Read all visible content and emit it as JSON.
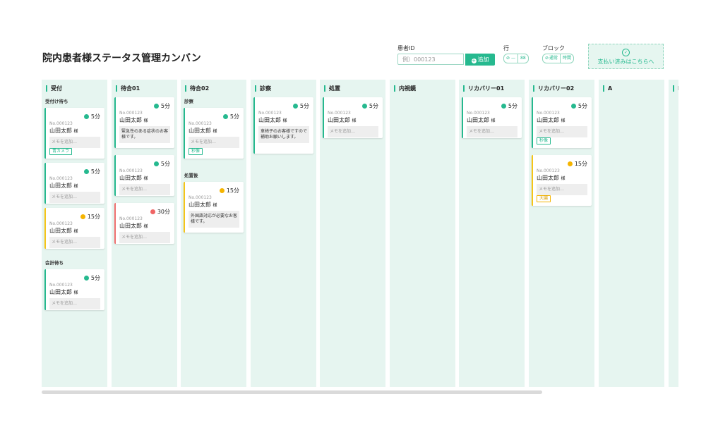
{
  "title": "院内患者様ステータス管理カンバン",
  "controls": {
    "patient_id_label": "患者ID",
    "patient_id_placeholder": "例）000123",
    "add_label": "追加",
    "row_label": "行",
    "row_toggle": [
      "—",
      "88"
    ],
    "block_label": "ブロック",
    "block_toggle": [
      "通常",
      "時間"
    ],
    "pay_label": "支払い済みはこちらへ"
  },
  "columns": [
    {
      "title": "受付",
      "groups": [
        {
          "label": "受付け待ち",
          "cards": [
            {
              "time": "5分",
              "status": "green",
              "no": "No.000123",
              "name": "山田太郎",
              "honor": "様",
              "memo": "メモを追加…",
              "memo_filled": false,
              "tag": "青カメラ",
              "tag_color": "green"
            },
            {
              "time": "5分",
              "status": "green",
              "no": "No.000123",
              "name": "山田太郎",
              "honor": "様",
              "memo": "メモを追加…",
              "memo_filled": false
            },
            {
              "time": "15分",
              "status": "yellow",
              "no": "No.000123",
              "name": "山田太郎",
              "honor": "様",
              "memo": "メモを追加…",
              "memo_filled": false
            }
          ]
        },
        {
          "label": "会計待ち",
          "cards": [
            {
              "time": "5分",
              "status": "green",
              "no": "No.000123",
              "name": "山田太郎",
              "honor": "様",
              "memo": "メモを追加…",
              "memo_filled": false
            }
          ]
        }
      ]
    },
    {
      "title": "待合01",
      "groups": [
        {
          "label": "",
          "cards": [
            {
              "time": "5分",
              "status": "green",
              "no": "No.000123",
              "name": "山田太郎",
              "honor": "様",
              "memo": "緊急性のある症状のお客様です。",
              "memo_filled": true
            },
            {
              "time": "5分",
              "status": "green",
              "no": "No.000123",
              "name": "山田太郎",
              "honor": "様",
              "memo": "メモを追加…",
              "memo_filled": false
            },
            {
              "time": "30分",
              "status": "red",
              "no": "No.000123",
              "name": "山田太郎",
              "honor": "様",
              "memo": "メモを追加…",
              "memo_filled": false
            }
          ]
        }
      ]
    },
    {
      "title": "待合02",
      "groups": [
        {
          "label": "診察",
          "cards": [
            {
              "time": "5分",
              "status": "green",
              "no": "No.000123",
              "name": "山田太郎",
              "honor": "様",
              "memo": "メモを追加…",
              "memo_filled": false,
              "tag": "秒像",
              "tag_color": "green"
            }
          ]
        },
        {
          "label": "処置後",
          "cards": [
            {
              "time": "15分",
              "status": "yellow",
              "no": "No.000123",
              "name": "山田太郎",
              "honor": "様",
              "memo": "外国語対応が必要なお客様です。",
              "memo_filled": true
            }
          ]
        }
      ]
    },
    {
      "title": "診察",
      "groups": [
        {
          "label": "",
          "cards": [
            {
              "time": "5分",
              "status": "green",
              "no": "No.000123",
              "name": "山田太郎",
              "honor": "様",
              "memo": "車椅子のお客様ですので補助お願いします。",
              "memo_filled": true
            }
          ]
        }
      ]
    },
    {
      "title": "処置",
      "groups": [
        {
          "label": "",
          "cards": [
            {
              "time": "5分",
              "status": "green",
              "no": "No.000123",
              "name": "山田太郎",
              "honor": "様",
              "memo": "メモを追加…",
              "memo_filled": false
            }
          ]
        }
      ]
    },
    {
      "title": "内視鏡",
      "groups": []
    },
    {
      "title": "リカバリー01",
      "groups": [
        {
          "label": "",
          "cards": [
            {
              "time": "5分",
              "status": "green",
              "no": "No.000123",
              "name": "山田太郎",
              "honor": "様",
              "memo": "メモを追加…",
              "memo_filled": false
            }
          ]
        }
      ]
    },
    {
      "title": "リカバリー02",
      "groups": [
        {
          "label": "",
          "cards": [
            {
              "time": "5分",
              "status": "green",
              "no": "No.000123",
              "name": "山田太郎",
              "honor": "様",
              "memo": "メモを追加…",
              "memo_filled": false,
              "tag": "秒像",
              "tag_color": "green"
            },
            {
              "time": "15分",
              "status": "yellow",
              "no": "No.000123",
              "name": "山田太郎",
              "honor": "様",
              "memo": "メモを追加…",
              "memo_filled": false,
              "tag": "大腸",
              "tag_color": "yellow"
            }
          ]
        }
      ]
    },
    {
      "title": "A",
      "groups": []
    },
    {
      "title": "E",
      "groups": []
    }
  ],
  "colors": {
    "accent": "#26b98f",
    "column_bg": "#e6f5f0",
    "warning": "#f5b400",
    "danger": "#f06464"
  }
}
